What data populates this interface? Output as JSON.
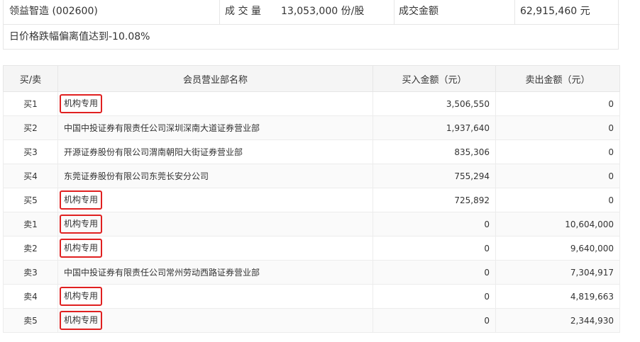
{
  "summary": {
    "stock": "领益智造 (002600)",
    "volume_label": "成 交 量",
    "volume_value": "13,053,000 份/股",
    "amount_label": "成交金额",
    "amount_value": "62,915,460 元",
    "reason": "日价格跌幅偏离值达到-10.08%"
  },
  "table": {
    "headers": [
      "买/卖",
      "会员营业部名称",
      "买入金额（元）",
      "卖出金额（元）"
    ],
    "rows": [
      {
        "type": "买1",
        "name": "机构专用",
        "buy": "3,506,550",
        "sell": "0",
        "highlight": true
      },
      {
        "type": "买2",
        "name": "中国中投证券有限责任公司深圳深南大道证券营业部",
        "buy": "1,937,640",
        "sell": "0",
        "highlight": false
      },
      {
        "type": "买3",
        "name": "开源证券股份有限公司渭南朝阳大街证券营业部",
        "buy": "835,306",
        "sell": "0",
        "highlight": false
      },
      {
        "type": "买4",
        "name": "东莞证券股份有限公司东莞长安分公司",
        "buy": "755,294",
        "sell": "0",
        "highlight": false
      },
      {
        "type": "买5",
        "name": "机构专用",
        "buy": "725,892",
        "sell": "0",
        "highlight": true
      },
      {
        "type": "卖1",
        "name": "机构专用",
        "buy": "0",
        "sell": "10,604,000",
        "highlight": true
      },
      {
        "type": "卖2",
        "name": "机构专用",
        "buy": "0",
        "sell": "9,640,000",
        "highlight": true
      },
      {
        "type": "卖3",
        "name": "中国中投证券有限责任公司常州劳动西路证券营业部",
        "buy": "0",
        "sell": "7,304,917",
        "highlight": false
      },
      {
        "type": "卖4",
        "name": "机构专用",
        "buy": "0",
        "sell": "4,819,663",
        "highlight": true
      },
      {
        "type": "卖5",
        "name": "机构专用",
        "buy": "0",
        "sell": "2,344,930",
        "highlight": true
      }
    ]
  },
  "colors": {
    "highlight_border": "#e02020",
    "header_bg": "#f5f5f5",
    "border": "#e6e6e6"
  }
}
